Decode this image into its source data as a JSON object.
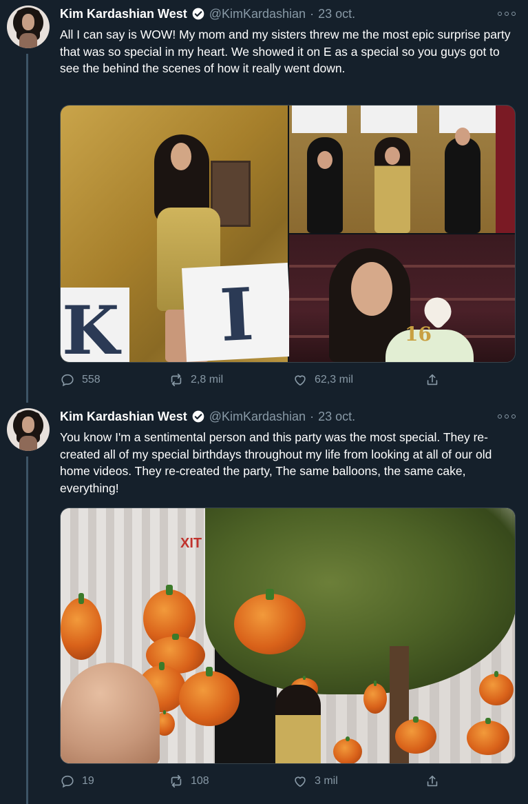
{
  "colors": {
    "background": "#15202b",
    "text_primary": "#ffffff",
    "text_secondary": "#8899a6",
    "verified_blue": "#1da1f2",
    "thread_line": "#3d5466"
  },
  "tweets": [
    {
      "display_name": "Kim Kardashian West",
      "handle": "@KimKardashian",
      "separator": "·",
      "date": "23 oct.",
      "text": "All I can say is WOW! My mom and my sisters threw me the most epic surprise party that was so special in my heart. We showed it on E as a special so you guys got to see the behind the scenes of how it really went down.",
      "media": {
        "sign_letter_1": "K",
        "sign_letter_2": "I",
        "cake_number": "16"
      },
      "actions": {
        "replies": "558",
        "retweets": "2,8 mil",
        "likes": "62,3 mil"
      },
      "icons": [
        "reply-icon",
        "retweet-icon",
        "like-icon",
        "share-icon",
        "more-options-icon",
        "verified-icon"
      ]
    },
    {
      "display_name": "Kim Kardashian West",
      "handle": "@KimKardashian",
      "separator": "·",
      "date": "23 oct.",
      "text": "You know I'm a sentimental person and this party was the most special. They re-created all of my special birthdays throughout my life from looking at all of our old home videos. They re-created the party, The same balloons, the same cake, everything!",
      "media": {
        "exit_sign": "XIT"
      },
      "actions": {
        "replies": "19",
        "retweets": "108",
        "likes": "3 mil"
      },
      "icons": [
        "reply-icon",
        "retweet-icon",
        "like-icon",
        "share-icon",
        "more-options-icon",
        "verified-icon"
      ]
    }
  ]
}
